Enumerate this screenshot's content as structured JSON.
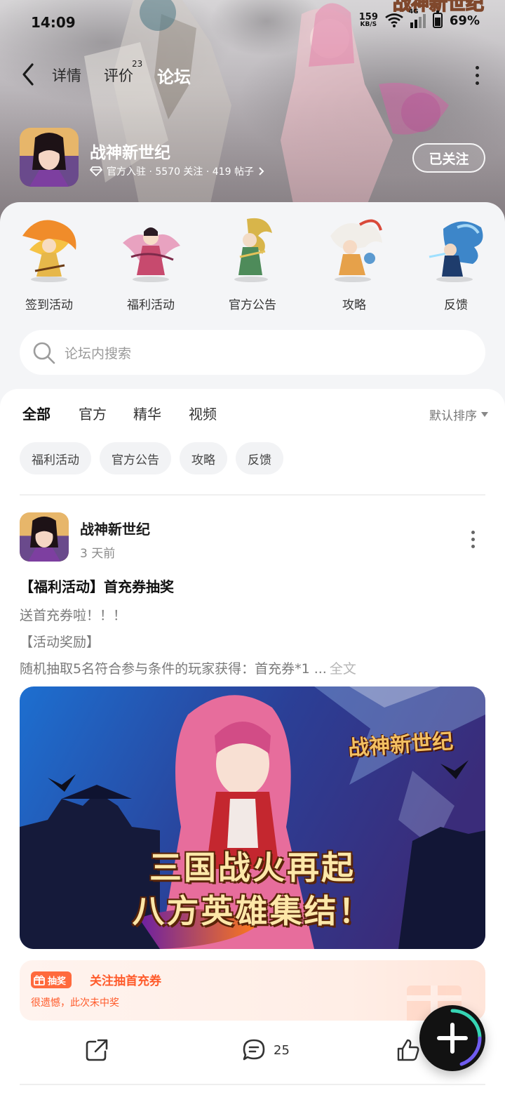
{
  "status_bar": {
    "time": "14:09",
    "net_speed": "159",
    "net_unit": "KB/S",
    "signal": "4G",
    "battery": "69%"
  },
  "nav": {
    "tabs": [
      {
        "label": "详情",
        "badge": ""
      },
      {
        "label": "评价",
        "badge": "23"
      },
      {
        "label": "论坛",
        "badge": ""
      }
    ],
    "active_tab": "论坛"
  },
  "game": {
    "name": "战神新世纪",
    "meta": "官方入驻 · 5570 关注 · 419 帖子",
    "follow_label": "已关注"
  },
  "categories": [
    {
      "label": "签到活动",
      "icon": "phoenix-hero-icon"
    },
    {
      "label": "福利活动",
      "icon": "dancer-hero-icon"
    },
    {
      "label": "官方公告",
      "icon": "dragon-warrior-icon"
    },
    {
      "label": "攻略",
      "icon": "white-beast-icon"
    },
    {
      "label": "反馈",
      "icon": "blue-dragon-icon"
    }
  ],
  "search": {
    "placeholder": "论坛内搜索"
  },
  "feed_tabs": [
    "全部",
    "官方",
    "精华",
    "视频"
  ],
  "feed_active_tab": "全部",
  "sort_label": "默认排序",
  "chips": [
    "福利活动",
    "官方公告",
    "攻略",
    "反馈"
  ],
  "post": {
    "author": "战神新世纪",
    "time": "3 天前",
    "title": "【福利活动】首充券抽奖",
    "lines": [
      "送首充券啦！！！",
      "【活动奖励】",
      "随机抽取5名符合参与条件的玩家获得：首充券*1 ..."
    ],
    "more_label": "全文",
    "image": {
      "logo": "战神新世纪",
      "line1": "三国战火再起",
      "line2": "八方英雄集结！"
    },
    "lottery": {
      "tag": "抽奖",
      "title": "关注抽首充券",
      "subtitle": "很遗憾，此次未中奖"
    },
    "comments": "25"
  },
  "colors": {
    "accent": "#2fd3b9",
    "lottery": "#ff5a2a",
    "fab": "#121212"
  }
}
